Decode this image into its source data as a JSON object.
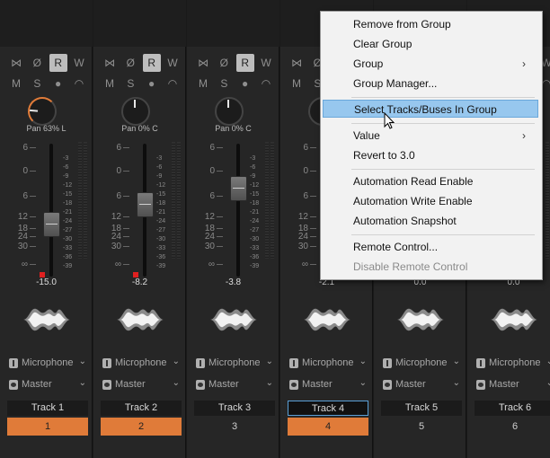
{
  "strip_buttons": {
    "row1": [
      "⋈",
      "Ø",
      "R",
      "W"
    ],
    "row2": [
      "M",
      "S",
      "●",
      "◠"
    ]
  },
  "fader_scale": [
    "6",
    "0",
    "6",
    "12",
    "18",
    "24",
    "30",
    "∞"
  ],
  "meter_scale": [
    "-3",
    "-6",
    "-9",
    "-12",
    "-15",
    "-18",
    "-21",
    "-24",
    "-27",
    "-30",
    "-33",
    "-36",
    "-39"
  ],
  "tracks": [
    {
      "pan": "Pan 63% L",
      "gain": "-15.0",
      "input": "Microphone",
      "output": "Master",
      "name": "Track 1",
      "number": "1",
      "pan_value": -0.63,
      "fader_db": -15.0,
      "selected_number": true,
      "clip": true
    },
    {
      "pan": "Pan 0% C",
      "gain": "-8.2",
      "input": "Microphone",
      "output": "Master",
      "name": "Track 2",
      "number": "2",
      "pan_value": 0,
      "fader_db": -8.2,
      "selected_number": true,
      "clip": true
    },
    {
      "pan": "Pan 0% C",
      "gain": "-3.8",
      "input": "Microphone",
      "output": "Master",
      "name": "Track 3",
      "number": "3",
      "pan_value": 0,
      "fader_db": -3.8,
      "selected_number": false,
      "clip": false
    },
    {
      "pan": "Pan",
      "gain": "-2.1",
      "input": "Microphone",
      "output": "Master",
      "name": "Track 4",
      "number": "4",
      "pan_value": 0,
      "fader_db": -2.1,
      "selected_number": true,
      "clip": false
    },
    {
      "pan": "",
      "gain": "0.0",
      "input": "Microphone",
      "output": "Master",
      "name": "Track 5",
      "number": "5",
      "pan_value": 0,
      "fader_db": 0,
      "selected_number": false,
      "clip": false
    },
    {
      "pan": "",
      "gain": "0.0",
      "input": "Microphone",
      "output": "Master",
      "name": "Track 6",
      "number": "6",
      "pan_value": 0,
      "fader_db": 0,
      "selected_number": false,
      "clip": false
    }
  ],
  "context_menu": {
    "items": [
      {
        "label": "Remove from Group",
        "enabled": true
      },
      {
        "label": "Clear Group",
        "enabled": true
      },
      {
        "label": "Group",
        "enabled": true,
        "submenu": "›"
      },
      {
        "label": "Group Manager...",
        "enabled": true
      },
      {
        "label": "Select Tracks/Buses In Group",
        "enabled": true,
        "highlighted": true
      },
      {
        "label": "Value",
        "enabled": true,
        "submenu": "›"
      },
      {
        "label": "Revert to 3.0",
        "enabled": true
      },
      {
        "label": "Automation Read Enable",
        "enabled": true
      },
      {
        "label": "Automation Write Enable",
        "enabled": true
      },
      {
        "label": "Automation Snapshot",
        "enabled": true
      },
      {
        "label": "Remote Control...",
        "enabled": true
      },
      {
        "label": "Disable Remote Control",
        "enabled": false
      }
    ]
  },
  "colors": {
    "accent_orange": "#e07b39",
    "selection_blue": "#97c7ee",
    "clip_red": "#e02020"
  }
}
